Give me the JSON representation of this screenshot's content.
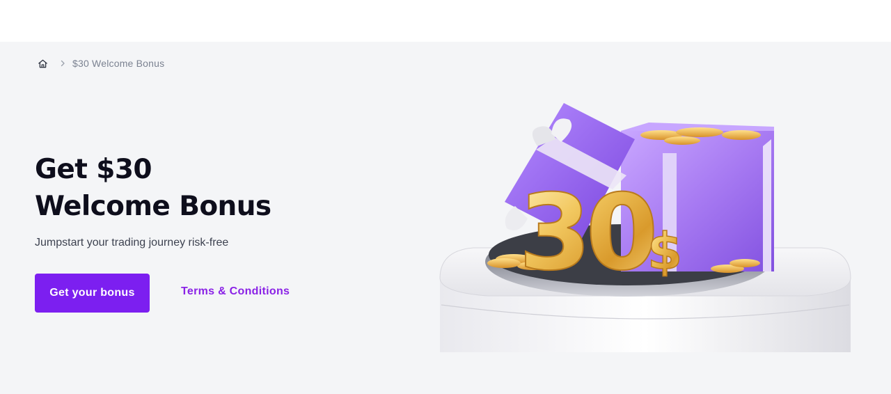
{
  "breadcrumb": {
    "home_icon": "home-icon",
    "separator_icon": "chevron-right-icon",
    "current": "$30 Welcome Bonus"
  },
  "hero": {
    "title_line1": "Get $30",
    "title_line2": "Welcome Bonus",
    "subtitle": "Jumpstart your trading journey risk-free",
    "cta_label": "Get your bonus",
    "terms_label": "Terms & Conditions"
  },
  "illustration": {
    "amount_text": "30",
    "currency_text": "$"
  },
  "colors": {
    "accent": "#7c1ff0",
    "link": "#8a22e6",
    "heading": "#0e0e1c",
    "background": "#f4f5f7"
  }
}
